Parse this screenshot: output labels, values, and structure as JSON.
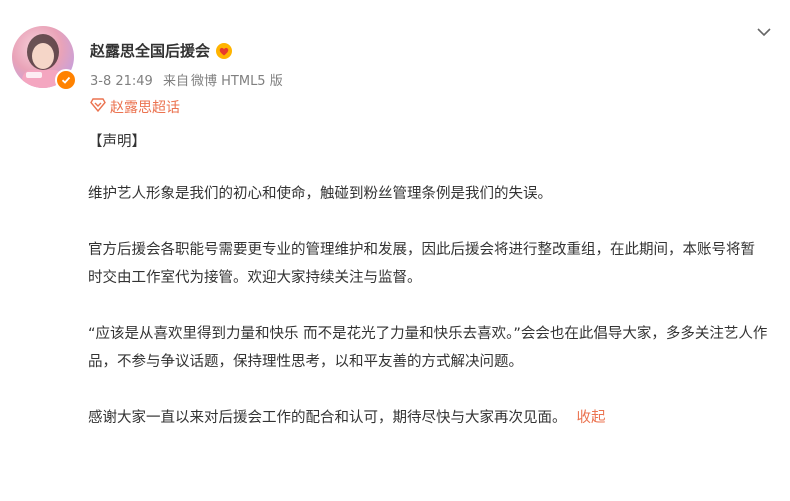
{
  "post": {
    "author": "赵露思全国后援会",
    "meta": {
      "time": "3-8 21:49",
      "source_prefix": "来自",
      "source": "微博 HTML5 版"
    },
    "topic": "赵露思超话",
    "paragraphs": [
      "【声明】",
      "维护艺人形象是我们的初心和使命，触碰到粉丝管理条例是我们的失误。",
      "官方后援会各职能号需要更专业的管理维护和发展，因此后援会将进行整改重组，在此期间，本账号将暂时交由工作室代为接管。欢迎大家持续关注与监督。",
      "“应该是从喜欢里得到力量和快乐 而不是花光了力量和快乐去喜欢。”会会也在此倡导大家，多多关注艺人作品，不参与争议话题，保持理性思考，以和平友善的方式解决问题。",
      "感谢大家一直以来对后援会工作的配合和认可，期待尽快与大家再次见面。"
    ],
    "collapse_label": "收起"
  },
  "colors": {
    "accent": "#eb7350",
    "verified": "#ff8200",
    "meta": "#808080"
  },
  "icons": {
    "chevron": "chevron-down-icon",
    "verified": "verified-badge-icon",
    "topic": "super-topic-icon",
    "fan": "fan-badge-icon"
  }
}
